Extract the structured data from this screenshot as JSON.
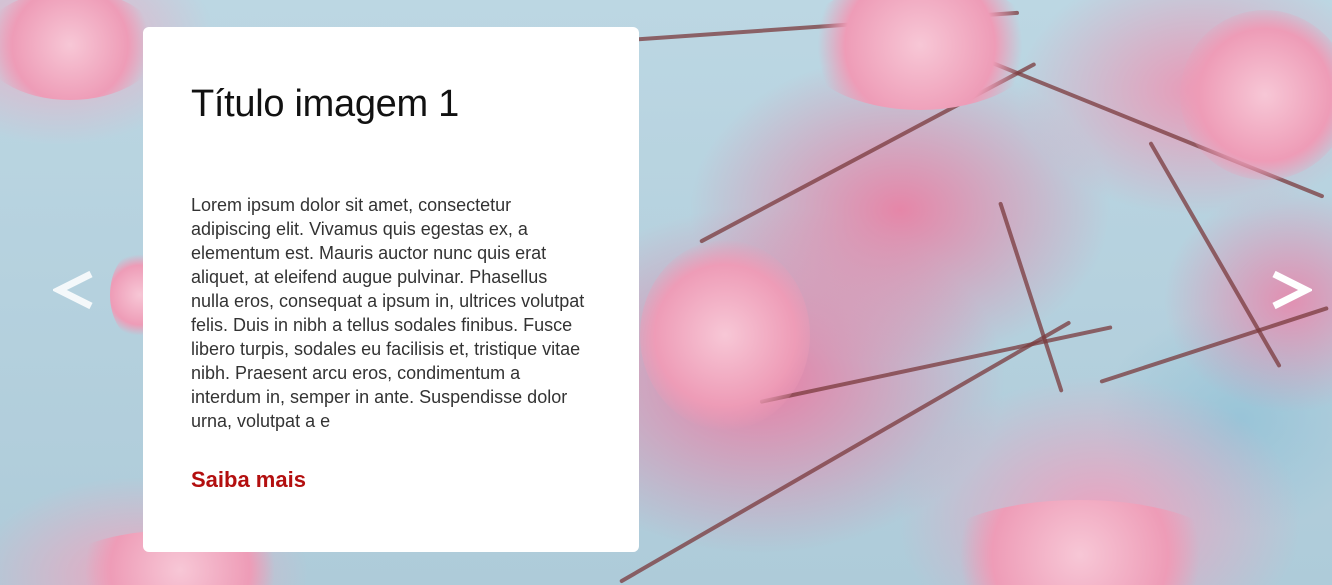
{
  "slide": {
    "title": "Título imagem 1",
    "text": "Lorem ipsum dolor sit amet, consectetur adipiscing elit. Vivamus quis egestas ex, a elementum est. Mauris auctor nunc quis erat aliquet, at eleifend augue pulvinar. Phasellus nulla eros, consequat a ipsum in, ultrices volutpat felis. Duis in nibh a tellus sodales finibus. Fusce libero turpis, sodales eu facilisis et, tristique vitae nibh. Praesent arcu eros, condimentum a interdum in, semper in ante. Suspendisse dolor urna, volutpat a e",
    "link_label": "Saiba mais"
  },
  "navigation": {
    "prev_icon": "chevron-left-icon",
    "next_icon": "chevron-right-icon"
  },
  "colors": {
    "link": "#b30f0f",
    "title": "#111111",
    "body_text": "#333333",
    "card_background": "#ffffff",
    "arrow": "#ffffff"
  }
}
